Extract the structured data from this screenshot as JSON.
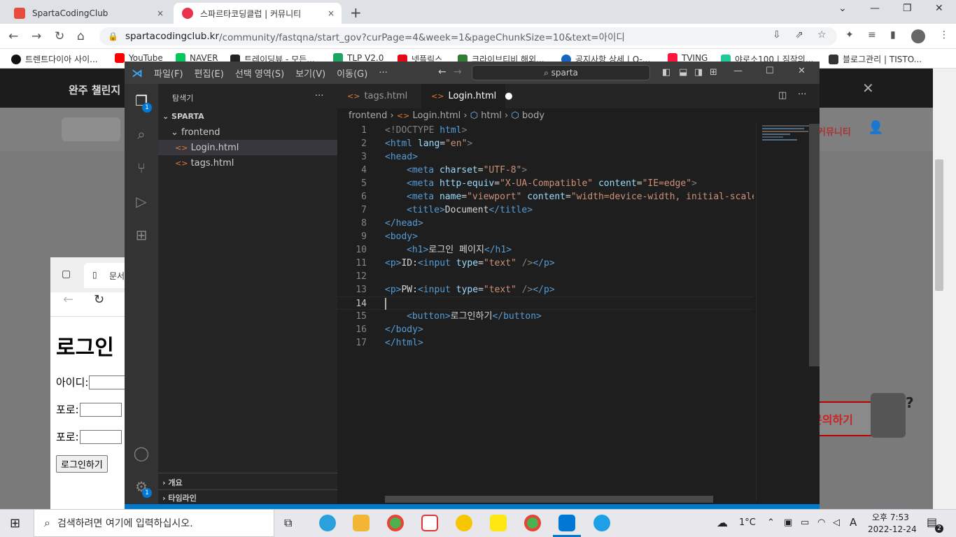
{
  "browser": {
    "tabs": [
      {
        "title": "SpartaCodingClub",
        "close": "×",
        "color": "#e74c3c"
      },
      {
        "title": "스파르타코딩클럽 | 커뮤니티",
        "close": "×",
        "color": "#e8344e"
      }
    ],
    "new_tab": "+",
    "url_host": "spartacodingclub.kr",
    "url_path": "/community/fastqna/start_gov?curPage=4&week=1&pageChunkSize=10&text=아이디",
    "bookmarks": [
      {
        "label": "트렌트다이아 사이...",
        "color": "#000000"
      },
      {
        "label": "YouTube",
        "color": "#ff0000"
      },
      {
        "label": "NAVER",
        "color": "#03c75a"
      },
      {
        "label": "트레이딩뷰 - 모든...",
        "color": "#222222"
      },
      {
        "label": "TLP V2.0",
        "color": "#1da462"
      },
      {
        "label": "넷플릭스",
        "color": "#e50914"
      },
      {
        "label": "크라이브티비 해외...",
        "color": "#2e7d32"
      },
      {
        "label": "공지사항 상세 | Q-...",
        "color": "#1565c0"
      },
      {
        "label": "TVING",
        "color": "#ff153c"
      },
      {
        "label": "야로소100 | 짐작의...",
        "color": "#20c997"
      },
      {
        "label": "블로그관리 | TISTO...",
        "color": "#333333"
      }
    ]
  },
  "site": {
    "banner_text": "완주 챌린지",
    "nav_community": "커뮤니티",
    "inquiry_button": "문의하기"
  },
  "mini_browser": {
    "tab_title": "문서",
    "heading": "로그인",
    "row1": "아이디:",
    "row2": "포로:",
    "row3": "포로:",
    "button": "로그인하기"
  },
  "vscode": {
    "menu": [
      "파일(F)",
      "편집(E)",
      "선택 영역(S)",
      "보기(V)",
      "이동(G)",
      "···"
    ],
    "search": "sparta",
    "explorer_title": "탐색기",
    "explorer_more": "···",
    "workspace": "SPARTA",
    "folder": "frontend",
    "files": [
      "Login.html",
      "tags.html"
    ],
    "outline": "개요",
    "timeline": "타임라인",
    "explorer_badge": "1",
    "settings_badge": "1",
    "tabs": [
      "tags.html",
      "Login.html"
    ],
    "breadcrumbs": [
      "frontend",
      "Login.html",
      "html",
      "body"
    ],
    "code_lines": [
      "1",
      "2",
      "3",
      "4",
      "5",
      "6",
      "7",
      "8",
      "9",
      "10",
      "11",
      "12",
      "13",
      "14",
      "15",
      "16",
      "17"
    ],
    "code": {
      "l1": [
        "<!DOCTYPE",
        " html",
        ">"
      ],
      "l2": [
        "<html",
        " lang",
        "=",
        "\"en\"",
        ">"
      ],
      "l3": [
        "<head>"
      ],
      "l4": [
        "<meta",
        " charset",
        "=",
        "\"UTF-8\"",
        ">"
      ],
      "l5": [
        "<meta",
        " http-equiv",
        "=",
        "\"X-UA-Compatible\"",
        " content",
        "=",
        "\"IE=edge\"",
        ">"
      ],
      "l6": [
        "<meta",
        " name",
        "=",
        "\"viewport\"",
        " content",
        "=",
        "\"width=device-width, initial-scale="
      ],
      "l7": [
        "<title>",
        "Document",
        "</title>"
      ],
      "l8": [
        "</head>"
      ],
      "l9": [
        "<body>"
      ],
      "l10": [
        "<h1>",
        "로그인 페이지",
        "</h1>"
      ],
      "l11": [
        "<p>",
        "ID:",
        "<input",
        " type",
        "=",
        "\"text\"",
        " />",
        "</p>"
      ],
      "l13": [
        "<p>",
        "PW:",
        "<input",
        " type",
        "=",
        "\"text\"",
        " />",
        "</p>"
      ],
      "l15": [
        "<button>",
        "로그인하기",
        "</button>"
      ],
      "l16": [
        "</body>"
      ],
      "l17": [
        "</html>"
      ]
    }
  },
  "taskbar": {
    "search_placeholder": "검색하려면 여기에 입력하십시오.",
    "weather": "1°C",
    "ime": "A",
    "time": "오후 7:53",
    "date": "2022-12-24",
    "notifications": "2"
  }
}
